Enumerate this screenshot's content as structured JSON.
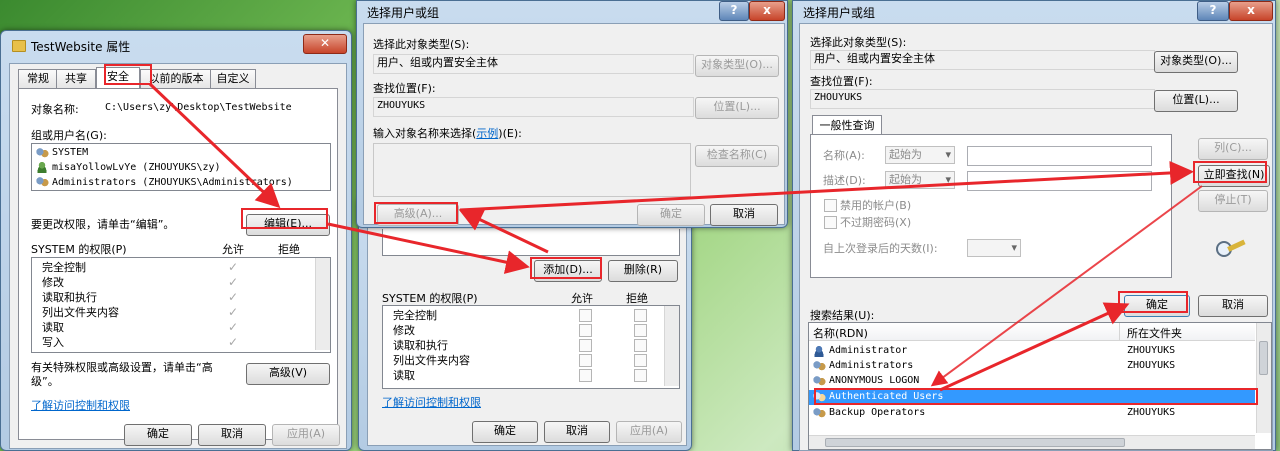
{
  "props": {
    "title": "TestWebsite 属性",
    "tabs": [
      "常规",
      "共享",
      "安全",
      "以前的版本",
      "自定义"
    ],
    "object_label": "对象名称:",
    "object_value": "C:\\Users\\zy\\Desktop\\TestWebsite",
    "group_label": "组或用户名(G):",
    "users": [
      "SYSTEM",
      "misaYollowLvYe (ZHOUYUKS\\zy)",
      "Administrators (ZHOUYUKS\\Administrators)"
    ],
    "change_text": "要更改权限，请单击“编辑”。",
    "edit_button": "编辑(E)...",
    "perm_label": "SYSTEM 的权限(P)",
    "allow": "允许",
    "deny": "拒绝",
    "perms": [
      "完全控制",
      "修改",
      "读取和执行",
      "列出文件夹内容",
      "读取",
      "写入"
    ],
    "special_text_1": "有关特殊权限或高级设置，请单击“高",
    "special_text_2": "级”。",
    "advanced_button": "高级(V)",
    "learn_link": "了解访问控制和权限",
    "ok": "确定",
    "cancel": "取消",
    "apply": "应用(A)"
  },
  "select_small": {
    "title": "选择用户或组",
    "help": "?",
    "close": "x",
    "type_label": "选择此对象类型(S):",
    "type_value": "用户、组或内置安全主体",
    "type_button": "对象类型(O)...",
    "loc_label": "查找位置(F):",
    "loc_value": "ZHOUYUKS",
    "loc_button": "位置(L)...",
    "enter_label_pre": "输入对象名称来选择(",
    "enter_label_link": "示例",
    "enter_label_post": ")(E):",
    "check_button": "检查名称(C)",
    "advanced_button": "高级(A)...",
    "ok": "确定",
    "cancel": "取消"
  },
  "perm_dialog": {
    "add_button": "添加(D)...",
    "remove_button": "删除(R)",
    "perm_label": "SYSTEM 的权限(P)",
    "allow": "允许",
    "deny": "拒绝",
    "perms": [
      "完全控制",
      "修改",
      "读取和执行",
      "列出文件夹内容",
      "读取"
    ],
    "learn_link": "了解访问控制和权限",
    "ok": "确定",
    "cancel": "取消",
    "apply": "应用(A)"
  },
  "select_adv": {
    "title": "选择用户或组",
    "help": "?",
    "close": "x",
    "type_label": "选择此对象类型(S):",
    "type_value": "用户、组或内置安全主体",
    "type_button": "对象类型(O)...",
    "loc_label": "查找位置(F):",
    "loc_value": "ZHOUYUKS",
    "loc_button": "位置(L)...",
    "query_tab": "一般性查询",
    "name_label": "名称(A):",
    "desc_label": "描述(D):",
    "starts_with": "起始为",
    "columns_button": "列(C)...",
    "find_now_button": "立即查找(N)",
    "stop_button": "停止(T)",
    "disabled_accounts": "禁用的帐户(B)",
    "non_expiring": "不过期密码(X)",
    "days_label": "自上次登录后的天数(I):",
    "ok": "确定",
    "cancel": "取消",
    "results_label": "搜索结果(U):",
    "col_name": "名称(RDN)",
    "col_folder": "所在文件夹",
    "results": [
      {
        "name": "Administrator",
        "folder": "ZHOUYUKS"
      },
      {
        "name": "Administrators",
        "folder": "ZHOUYUKS"
      },
      {
        "name": "ANONYMOUS LOGON",
        "folder": ""
      },
      {
        "name": "Authenticated Users",
        "folder": ""
      },
      {
        "name": "Backup Operators",
        "folder": "ZHOUYUKS"
      }
    ]
  },
  "colors": {
    "highlight": "#e8262b",
    "selection": "#3399ff"
  }
}
